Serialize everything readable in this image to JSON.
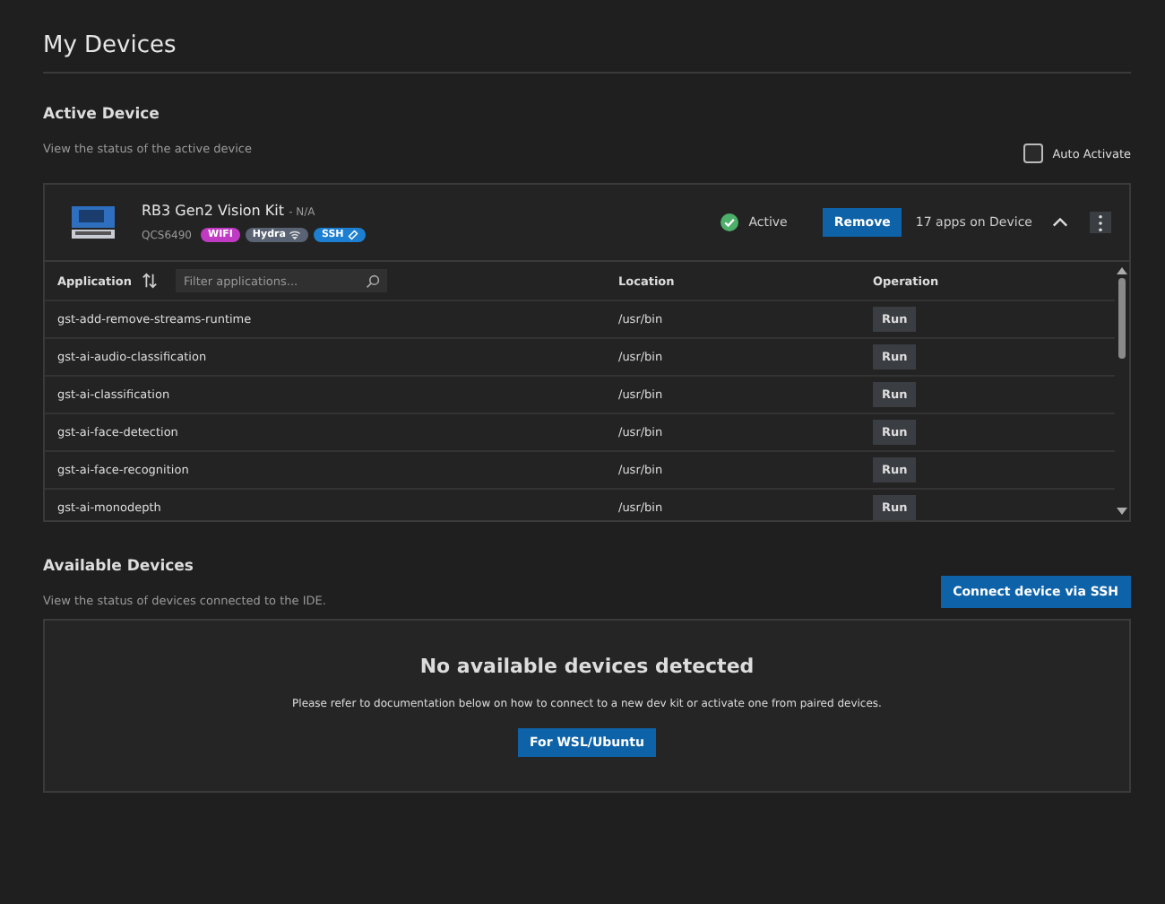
{
  "page_title": "My Devices",
  "active_section": {
    "title": "Active Device",
    "subtitle": "View the status of the active device",
    "auto_activate": {
      "label": "Auto Activate",
      "checked": false
    }
  },
  "device": {
    "name": "RB3 Gen2 Vision Kit",
    "suffix": "- N/A",
    "chip": "QCS6490",
    "badges": [
      {
        "label": "WIFI",
        "color": "#c03bc4"
      },
      {
        "label": "Hydra",
        "color": "#5a6373"
      },
      {
        "label": "SSH",
        "color": "#1d7fd1"
      }
    ],
    "status": "Active",
    "remove_label": "Remove",
    "apps_count": "17 apps on Device",
    "expanded": true
  },
  "table": {
    "columns": [
      "Application",
      "Location",
      "Operation"
    ],
    "filter_placeholder": "Filter applications...",
    "rows": [
      {
        "application": "gst-add-remove-streams-runtime",
        "location": "/usr/bin",
        "action": "Run"
      },
      {
        "application": "gst-ai-audio-classification",
        "location": "/usr/bin",
        "action": "Run"
      },
      {
        "application": "gst-ai-classification",
        "location": "/usr/bin",
        "action": "Run"
      },
      {
        "application": "gst-ai-face-detection",
        "location": "/usr/bin",
        "action": "Run"
      },
      {
        "application": "gst-ai-face-recognition",
        "location": "/usr/bin",
        "action": "Run"
      },
      {
        "application": "gst-ai-monodepth",
        "location": "/usr/bin",
        "action": "Run"
      }
    ]
  },
  "available_section": {
    "title": "Available Devices",
    "subtitle": "View the status of devices connected to the IDE.",
    "connect_label": "Connect device via SSH",
    "empty_title": "No available devices detected",
    "empty_text": "Please refer to documentation below on how to connect to a new dev kit or activate one from paired devices.",
    "doc_button": "For WSL/Ubuntu"
  }
}
